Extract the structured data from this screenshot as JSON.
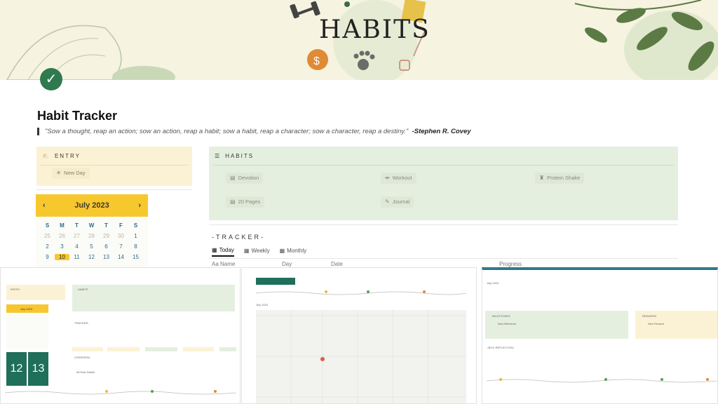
{
  "banner": {
    "title": "HABITS",
    "icons": [
      "dumbbell-icon",
      "money-bag-icon",
      "paw-icon",
      "book-icon",
      "quill-icon",
      "checkmark-icon"
    ]
  },
  "page": {
    "title": "Habit Tracker",
    "quote": "\"Sow a thought, reap an action; sow an action, reap a habit; sow a habit, reap a character; sow a character, reap a destiny.\"",
    "quote_author": "-Stephen R. Covey"
  },
  "entry": {
    "heading": "ENTRY",
    "button": "New Day"
  },
  "calendar": {
    "month": "July 2023",
    "prev": "‹",
    "next": "›",
    "weekdays": [
      "S",
      "M",
      "T",
      "W",
      "T",
      "F",
      "S"
    ],
    "rows": [
      [
        "25",
        "26",
        "27",
        "28",
        "29",
        "30",
        "1"
      ],
      [
        "2",
        "3",
        "4",
        "5",
        "6",
        "7",
        "8"
      ],
      [
        "9",
        "10",
        "11",
        "12",
        "13",
        "14",
        "15"
      ]
    ],
    "today": "10"
  },
  "habits": {
    "heading": "HABITS",
    "items": [
      "Devotion",
      "Workout",
      "Protein Shake",
      "20 Pages",
      "Journal"
    ]
  },
  "tracker": {
    "heading": "-TRACKER-",
    "tabs": [
      "Today",
      "Weekly",
      "Monthly"
    ],
    "columns": [
      "Aa Name",
      "Day",
      "Date",
      "Progress"
    ]
  },
  "thumb1": {
    "entry": "ENTRY",
    "habits": "HABITS",
    "tracker": "-TRACKER-",
    "overview": "-OVERVIEW-",
    "month": "July 2023",
    "day1": "12",
    "day2": "13",
    "new_habits": "All New Habits"
  },
  "thumb2": {
    "month": "July 2023"
  },
  "thumb3": {
    "month": "July 2023",
    "milestones": "MILESTONES",
    "rewards": "REWARDS",
    "milestone_item": "New Milestone",
    "reward_item": "New Reward",
    "self_reflection": "-SELF-REFLECTION-"
  },
  "colors": {
    "banner_bg": "#f6f3e1",
    "entry_bg": "#fbf2d5",
    "habits_bg": "#e5efe0",
    "calendar_head": "#f7c72e",
    "badge": "#2f7a4f",
    "calendar_tile": "#1f6f5a"
  }
}
